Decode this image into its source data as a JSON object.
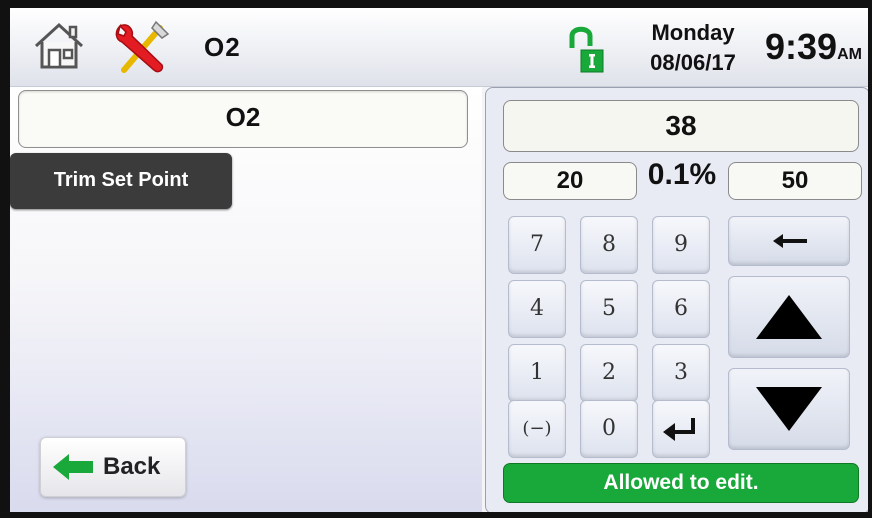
{
  "header": {
    "title": "O2",
    "day": "Monday",
    "date": "08/06/17",
    "time": "9:39",
    "ampm": "AM",
    "icons": [
      "home-icon",
      "tools-icon",
      "lock-icon"
    ],
    "colors": {
      "lock_green": "#19a83a",
      "tools_red": "#e31b23",
      "tools_yellow": "#f0c419"
    }
  },
  "left": {
    "parameter_name": "O2",
    "trim_button": "Trim Set Point",
    "back_button": "Back",
    "back_arrow_color": "#19a83a"
  },
  "keypad": {
    "value": "38",
    "min": "20",
    "step": "0.1%",
    "max": "50",
    "keys": {
      "k7": "7",
      "k8": "8",
      "k9": "9",
      "k4": "4",
      "k5": "5",
      "k6": "6",
      "k1": "1",
      "k2": "2",
      "k3": "3",
      "neg": "(−)",
      "k0": "0"
    },
    "status": "Allowed to edit.",
    "status_color": "#19a83a"
  }
}
